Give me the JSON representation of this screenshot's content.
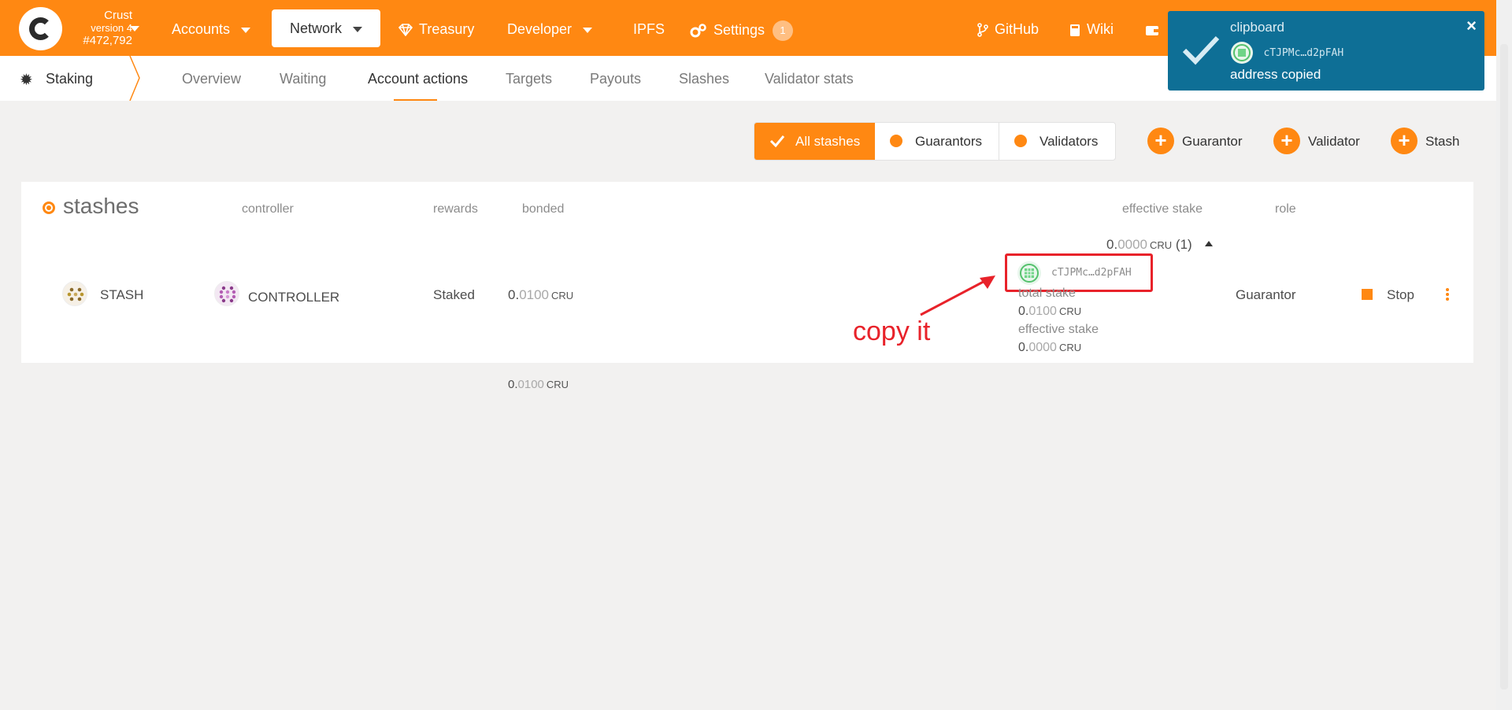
{
  "chain": {
    "name": "Crust",
    "version": "version 4",
    "block": "#472,792"
  },
  "nav": {
    "accounts": "Accounts",
    "network": "Network",
    "treasury": "Treasury",
    "developer": "Developer",
    "ipfs": "IPFS",
    "settings": "Settings",
    "settings_badge": "1",
    "github": "GitHub",
    "wiki": "Wiki"
  },
  "subnav": {
    "title": "Staking",
    "tabs": [
      "Overview",
      "Waiting",
      "Account actions",
      "Targets",
      "Payouts",
      "Slashes",
      "Validator stats"
    ],
    "active_tab": "Account actions"
  },
  "filters": {
    "all": "All stashes",
    "guarantors": "Guarantors",
    "validators": "Validators"
  },
  "actions": {
    "guarantor": "Guarantor",
    "validator": "Validator",
    "stash": "Stash"
  },
  "table": {
    "headers": {
      "stashes": "stashes",
      "controller": "controller",
      "rewards": "rewards",
      "bonded": "bonded",
      "effective_stake": "effective stake",
      "role": "role"
    },
    "row": {
      "stash": "STASH",
      "controller": "CONTROLLER",
      "rewards": "Staked",
      "bonded_int": "0.",
      "bonded_dec": "0100",
      "bonded_unit": "CRU",
      "eff_int": "0.",
      "eff_dec": "0000",
      "eff_unit": "CRU",
      "eff_count": "(1)",
      "addr": "cTJPMc…d2pFAH",
      "total_stake_label": "total stake",
      "total_int": "0.",
      "total_dec": "0100",
      "total_unit": "CRU",
      "eff_stake_label": "effective stake",
      "eff2_int": "0.",
      "eff2_dec": "0000",
      "eff2_unit": "CRU",
      "role": "Guarantor",
      "stop": "Stop"
    },
    "footer": {
      "bonded_int": "0.",
      "bonded_dec": "0100",
      "bonded_unit": "CRU"
    }
  },
  "annotation": {
    "text": "copy it",
    "color": "#e8222a"
  },
  "toast": {
    "title": "clipboard",
    "address": "cTJPMc…d2pFAH",
    "message": "address copied",
    "close": "×"
  },
  "colors": {
    "accent": "#ff8812",
    "toast": "#0e6f96"
  },
  "icons": [
    "chevron-down-icon",
    "treasury-gem-icon",
    "settings-gears-icon",
    "github-fork-icon",
    "wiki-book-icon",
    "wallet-icon",
    "gear-icon",
    "check-icon",
    "plus-icon",
    "identicon",
    "close-icon",
    "kebab-icon"
  ]
}
